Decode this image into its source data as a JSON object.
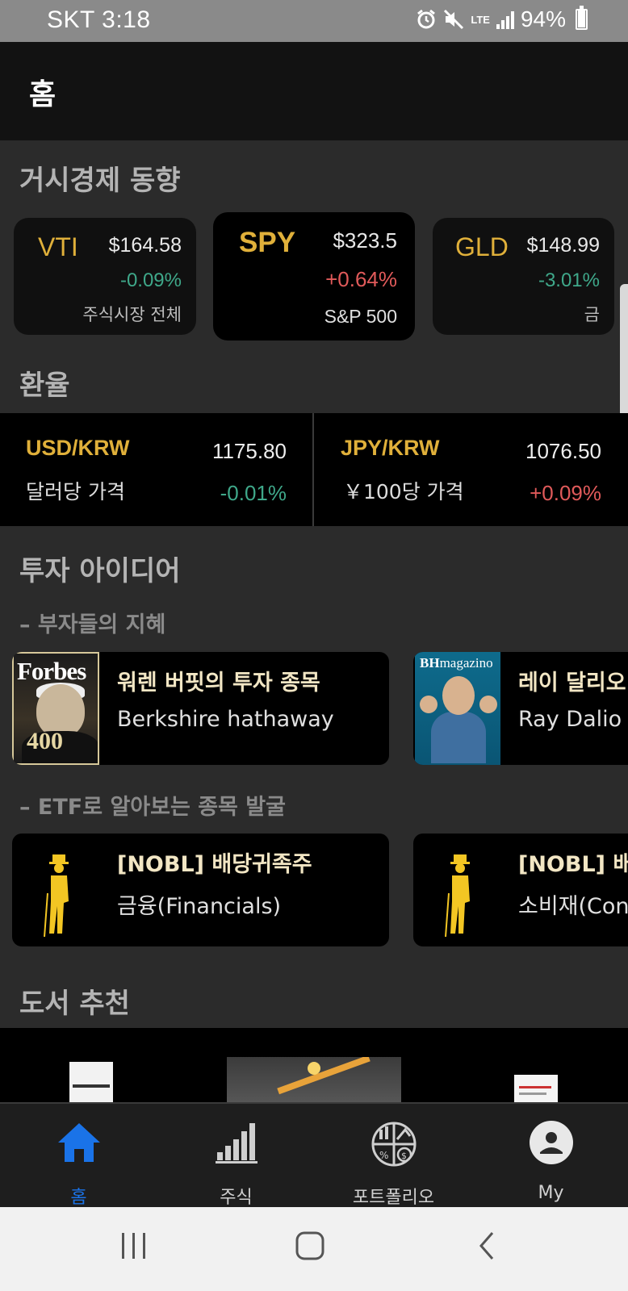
{
  "status_bar": {
    "carrier_time": "SKT 3:18",
    "network": "LTE",
    "battery": "94%",
    "battery_level": 0.94,
    "icons": [
      "alarm-icon",
      "mute-icon",
      "lte-icon",
      "signal-icon",
      "battery-icon"
    ]
  },
  "header": {
    "title": "홈"
  },
  "macro": {
    "title": "거시경제 동향",
    "cards": [
      {
        "symbol": "VTI",
        "price": "$164.58",
        "change": "-0.09%",
        "desc": "주식시장 전체",
        "direction": "down"
      },
      {
        "symbol": "SPY",
        "price": "$323.5",
        "change": "+0.64%",
        "desc": "S&P 500",
        "direction": "up"
      },
      {
        "symbol": "GLD",
        "price": "$148.99",
        "change": "-3.01%",
        "desc": "금",
        "direction": "down"
      }
    ]
  },
  "fx": {
    "title": "환율",
    "items": [
      {
        "pair": "USD/KRW",
        "value": "1175.80",
        "desc": "달러당 가격",
        "change": "-0.01%",
        "direction": "down"
      },
      {
        "pair": "JPY/KRW",
        "value": "1076.50",
        "desc": "￥100당 가격",
        "change": "+0.09%",
        "direction": "up"
      }
    ]
  },
  "ideas": {
    "title": "투자 아이디어",
    "wisdom": {
      "subtitle": "– 부자들의 지혜",
      "cards": [
        {
          "title": "워렌 버핏의 투자 종목",
          "subtitle": "Berkshire hathaway",
          "thumb_logo": "Forbes",
          "thumb_number": "400"
        },
        {
          "title": "레이 달리오",
          "subtitle": "Ray Dalio",
          "thumb_logo_bold": "BH",
          "thumb_logo_rest": "magazino"
        }
      ]
    },
    "etf": {
      "subtitle": "– ETF로 알아보는 종목 발굴",
      "cards": [
        {
          "title": "[NOBL] 배당귀족주",
          "subtitle": "금융(Financials)"
        },
        {
          "title": "[NOBL] 배당",
          "subtitle": "소비재(Cons"
        }
      ]
    }
  },
  "books": {
    "title": "도서 추천"
  },
  "bottom_nav": [
    {
      "label": "홈",
      "icon": "home-icon",
      "active": true
    },
    {
      "label": "주식",
      "icon": "bar-chart-icon",
      "active": false
    },
    {
      "label": "포트폴리오",
      "icon": "portfolio-icon",
      "active": false
    },
    {
      "label": "My",
      "icon": "profile-icon",
      "active": false
    }
  ],
  "colors": {
    "gold": "#e0b03a",
    "up": "#e05a5a",
    "down": "#3fa88a",
    "active": "#1a73e8"
  }
}
